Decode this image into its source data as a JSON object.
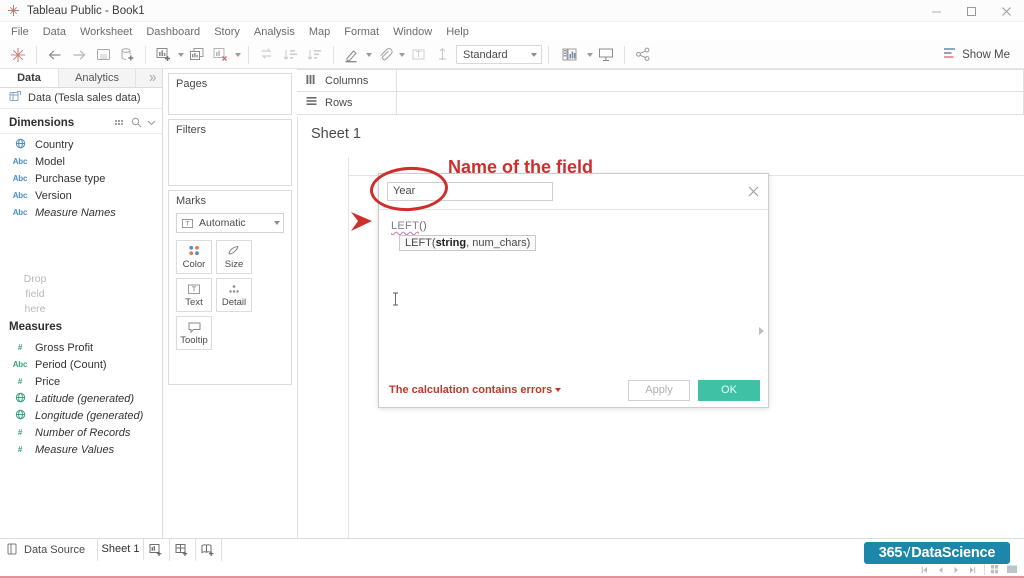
{
  "window": {
    "title": "Tableau Public - Book1",
    "logo_icon": "tableau-logo-icon",
    "controls": [
      {
        "name": "minimize",
        "icon": "minimize-icon"
      },
      {
        "name": "maximize",
        "icon": "maximize-icon"
      },
      {
        "name": "close",
        "icon": "close-icon"
      }
    ]
  },
  "menubar": {
    "items": [
      "File",
      "Data",
      "Worksheet",
      "Dashboard",
      "Story",
      "Analysis",
      "Map",
      "Format",
      "Window",
      "Help"
    ]
  },
  "toolbar": {
    "buttons": [
      {
        "name": "tableau-home-icon",
        "label": ""
      },
      {
        "name": "undo-icon",
        "label": ""
      },
      {
        "name": "redo-icon",
        "label": ""
      },
      {
        "name": "save-icon",
        "label": ""
      },
      {
        "name": "new-data-source-icon",
        "label": ""
      },
      {
        "name": "new-worksheet-icon",
        "label": ""
      },
      {
        "name": "duplicate-sheet-icon",
        "label": ""
      },
      {
        "name": "clear-sheet-icon",
        "label": ""
      },
      {
        "name": "swap-rows-columns-icon",
        "label": ""
      },
      {
        "name": "sort-ascending-icon",
        "label": ""
      },
      {
        "name": "sort-descending-icon",
        "label": ""
      },
      {
        "name": "highlight-icon",
        "label": ""
      },
      {
        "name": "group-members-icon",
        "label": ""
      },
      {
        "name": "show-mark-labels-icon",
        "label": ""
      },
      {
        "name": "fix-axes-icon",
        "label": ""
      },
      {
        "name": "presentation-mode-icon",
        "label": ""
      },
      {
        "name": "share-icon",
        "label": ""
      }
    ],
    "fit_select": {
      "value": "Standard"
    },
    "show_me": {
      "label": "Show Me",
      "icon": "show-me-icon"
    }
  },
  "data_pane": {
    "tabs": [
      {
        "label": "Data",
        "active": true
      },
      {
        "label": "Analytics",
        "active": false
      }
    ],
    "data_source": {
      "label": "Data (Tesla sales data)",
      "icon": "data-source-icon"
    },
    "dimensions": {
      "header": "Dimensions",
      "icons": [
        "grid-view-icon",
        "search-icon",
        "chevron-down-icon"
      ],
      "fields": [
        {
          "label": "Country",
          "type": "globe",
          "italic": false
        },
        {
          "label": "Model",
          "type": "Abc",
          "italic": false
        },
        {
          "label": "Purchase type",
          "type": "Abc",
          "italic": false
        },
        {
          "label": "Version",
          "type": "Abc",
          "italic": false
        },
        {
          "label": "Measure Names",
          "type": "Abc",
          "italic": true
        }
      ]
    },
    "measures": {
      "header": "Measures",
      "fields": [
        {
          "label": "Gross Profit",
          "type": "#",
          "italic": false
        },
        {
          "label": "Period (Count)",
          "type": "Abc",
          "italic": false
        },
        {
          "label": "Price",
          "type": "#",
          "italic": false
        },
        {
          "label": "Latitude (generated)",
          "type": "globe",
          "italic": true
        },
        {
          "label": "Longitude (generated)",
          "type": "globe",
          "italic": true
        },
        {
          "label": "Number of Records",
          "type": "#",
          "italic": true
        },
        {
          "label": "Measure Values",
          "type": "#",
          "italic": true
        }
      ]
    }
  },
  "cards": {
    "pages": {
      "title": "Pages"
    },
    "filters": {
      "title": "Filters"
    },
    "marks": {
      "title": "Marks",
      "mark_type": {
        "value": "Automatic",
        "icon": "text-mark-icon"
      },
      "buttons": [
        {
          "label": "Color",
          "icon": "color-icon"
        },
        {
          "label": "Size",
          "icon": "size-icon"
        },
        {
          "label": "Text",
          "icon": "text-icon"
        },
        {
          "label": "Detail",
          "icon": "detail-icon"
        },
        {
          "label": "Tooltip",
          "icon": "tooltip-icon"
        }
      ]
    }
  },
  "shelves": [
    {
      "label": "Columns",
      "icon": "columns-icon"
    },
    {
      "label": "Rows",
      "icon": "rows-icon"
    }
  ],
  "canvas": {
    "sheet_title": "Sheet 1",
    "drop_field_here": "Drop field here"
  },
  "calc_dialog": {
    "name_value": "Year",
    "name_placeholder": "",
    "close_icon": "close-icon",
    "formula_function": "LEFT",
    "formula_parens": "()",
    "tooltip_prefix": "LEFT(",
    "tooltip_bold": "string",
    "tooltip_suffix": ", num_chars)",
    "error_text": "The calculation contains errors",
    "apply_label": "Apply",
    "ok_label": "OK",
    "ok_color": "#3fc1a5"
  },
  "annotations": {
    "label": "Name of the field",
    "color": "#cf2e2e"
  },
  "statusbar": {
    "data_source": {
      "label": "Data Source",
      "icon": "data-source-tab-icon"
    },
    "sheet_tab": {
      "label": "Sheet 1"
    },
    "tab_buttons": [
      {
        "name": "new-worksheet-tab-icon"
      },
      {
        "name": "new-dashboard-tab-icon"
      },
      {
        "name": "new-story-tab-icon"
      }
    ],
    "nav_buttons": [
      "first-icon",
      "previous-icon",
      "next-icon",
      "last-icon",
      "show-sheets-icon",
      "show-filmstrip-icon"
    ]
  },
  "brand": {
    "prefix": "365",
    "root": "√",
    "suffix": "DataScience",
    "color": "#1c87a8"
  }
}
